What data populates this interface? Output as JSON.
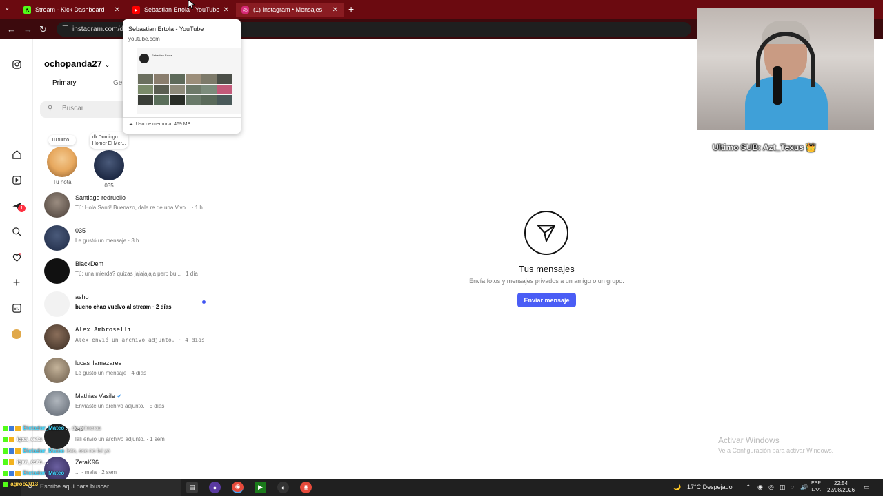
{
  "browser": {
    "tabs": [
      {
        "title": "Stream - Kick Dashboard"
      },
      {
        "title": "Sebastian Ertola - YouTube"
      },
      {
        "title": "(1) Instagram • Mensajes"
      }
    ],
    "url": "instagram.com/direct/inbox/"
  },
  "hovercard": {
    "title": "Sebastian Ertola - YouTube",
    "url": "youtube.com",
    "preview_channel": "Sebastian Ertola",
    "memory": "Uso de memoria: 469 MB"
  },
  "instagram": {
    "username": "ochopanda27",
    "tabs": {
      "primary": "Primary",
      "general": "General"
    },
    "search_placeholder": "Buscar",
    "notes": [
      {
        "bubble": "Tu turno...",
        "caption": "Tu nota"
      },
      {
        "bubble_line1": "ıllı Domingo",
        "bubble_line2": "Homer El Mer...",
        "caption": "035"
      }
    ],
    "notifications_badge": "1",
    "conversations": [
      {
        "name": "Santiago redruello",
        "preview": "Tú: Hola Santi! Buenazo, dale re de una Vivo... · 1 h"
      },
      {
        "name": "035",
        "preview": "Le gustó un mensaje · 3 h"
      },
      {
        "name": "BlackDem",
        "preview": "Tú: una mierda? quizas jajajajaja pero bu... · 1 día"
      },
      {
        "name": "asho",
        "preview": "bueno chao vuelvo al stream · 2 días"
      },
      {
        "name": "Alex Ambroselli",
        "preview": "Alex envió un archivo adjunto. · 4 días"
      },
      {
        "name": "lucas llamazares",
        "preview": "Le gustó un mensaje · 4 días"
      },
      {
        "name": "Mathias Vasile",
        "preview": "Enviaste un archivo adjunto. · 5 días"
      },
      {
        "name": "lali",
        "preview": "lali envió un archivo adjunto. · 1 sem"
      },
      {
        "name": "ZetaK96",
        "preview": "... · mala · 2 sem"
      }
    ],
    "empty_state": {
      "title": "Tus mensajes",
      "subtitle": "Envía fotos y mensajes privados a un amigo o un grupo.",
      "button": "Enviar mensaje"
    }
  },
  "windows_watermark": {
    "title": "Activar Windows",
    "subtitle": "Ve a Configuración para activar Windows."
  },
  "stream": {
    "last_sub": "Ultimo SUB: Azt_Texus 👑",
    "chat": [
      {
        "user": "Dictador_Mateo",
        "text": "... de primeras",
        "color": "#3ed8ff"
      },
      {
        "user": "igaa_esta",
        "text": "",
        "color": "#ffffff"
      },
      {
        "user": "Dictador_Mateo",
        "text": "listo, ese no fui yo",
        "color": "#3ed8ff"
      },
      {
        "user": "igaa_esta",
        "text": "...",
        "color": "#ffffff"
      },
      {
        "user": "Dictador_Mateo",
        "text": "",
        "color": "#3ed8ff"
      },
      {
        "user": "agroo2013",
        "text": "",
        "color": "#ffd24a"
      }
    ]
  },
  "taskbar": {
    "search_placeholder": "Escribe aquí para buscar.",
    "weather": "17°C  Despejado",
    "lang_line1": "ESP",
    "lang_line2": "LAA",
    "time": "22:54",
    "date": "22/08/2026"
  },
  "colors": {
    "tabbar": "#6b0a10",
    "accent": "#4a5df5",
    "unread_dot": "#4054f2"
  }
}
